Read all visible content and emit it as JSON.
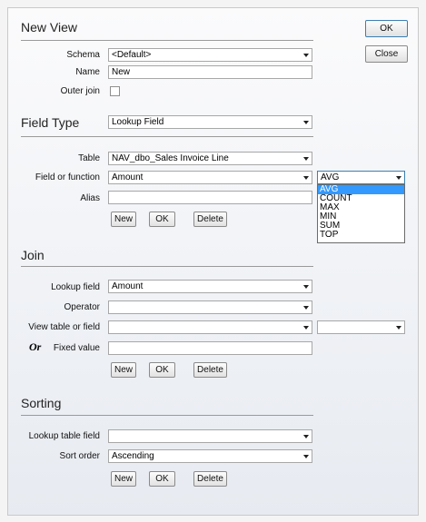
{
  "header": {
    "title": "New View"
  },
  "buttons": {
    "ok": "OK",
    "close": "Close"
  },
  "view": {
    "schema_label": "Schema",
    "schema_value": "<Default>",
    "name_label": "Name",
    "name_value": "New",
    "outer_join_label": "Outer join"
  },
  "field_type": {
    "title": "Field Type",
    "value": "Lookup Field",
    "table_label": "Table",
    "table_value": "NAV_dbo_Sales Invoice Line",
    "field_label": "Field or function",
    "field_value": "Amount",
    "function_value": "AVG",
    "function_options": [
      "AVG",
      "COUNT",
      "MAX",
      "MIN",
      "SUM",
      "TOP"
    ],
    "alias_label": "Alias",
    "alias_value": "",
    "new": "New",
    "ok": "OK",
    "delete": "Delete"
  },
  "join": {
    "title": "Join",
    "lookup_label": "Lookup field",
    "lookup_value": "Amount",
    "operator_label": "Operator",
    "operator_value": "",
    "view_table_label": "View table or field",
    "view_table_value": "",
    "view_table_value2": "",
    "or_label": "Or",
    "fixed_label": "Fixed value",
    "fixed_value": "",
    "new": "New",
    "ok": "OK",
    "delete": "Delete"
  },
  "sorting": {
    "title": "Sorting",
    "lookup_table_label": "Lookup table field",
    "lookup_table_value": "",
    "sort_order_label": "Sort order",
    "sort_order_value": "Ascending",
    "new": "New",
    "ok": "OK",
    "delete": "Delete"
  }
}
